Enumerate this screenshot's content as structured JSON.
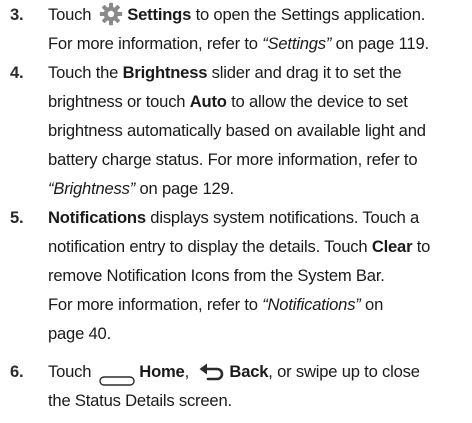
{
  "steps": [
    {
      "number": "3.",
      "lines": [
        {
          "pre": "Touch",
          "icon": "gear-icon",
          "bold": "Settings",
          "post": " to open the Settings application."
        },
        {
          "pre": "For more information, refer to ",
          "italic": "“Settings”",
          "post": " on page 119."
        }
      ]
    },
    {
      "number": "4.",
      "lines": [
        {
          "pre": "Touch the ",
          "bold": "Brightness",
          "post": " slider and drag it to set the"
        },
        {
          "pre": "brightness or touch ",
          "bold": "Auto",
          "post": " to allow the device to set"
        },
        {
          "text": "brightness automatically based on available light and"
        },
        {
          "text": "battery charge status. For more information, refer to"
        },
        {
          "italic": "“Brightness”",
          "post": " on page 129."
        }
      ]
    },
    {
      "number": "5.",
      "lines": [
        {
          "bold": "Notifications",
          "post": " displays system notifications. Touch a"
        },
        {
          "pre": "notification entry to display the details. Touch ",
          "bold": "Clear",
          "post": " to"
        },
        {
          "text": "remove Notification Icons from the System Bar."
        },
        {
          "pre": "For more information, refer to ",
          "italic": "“Notifications”",
          "post": " on"
        },
        {
          "text": "page 40."
        }
      ]
    },
    {
      "number": "6.",
      "lines": [
        {
          "pre": "Touch",
          "icon1": "home-icon",
          "bold1": "Home",
          "mid": ", ",
          "icon2": "back-arrow-icon",
          "bold2": "Back",
          "post": ", or swipe up to close"
        },
        {
          "text": "the Status Details screen."
        }
      ]
    }
  ]
}
